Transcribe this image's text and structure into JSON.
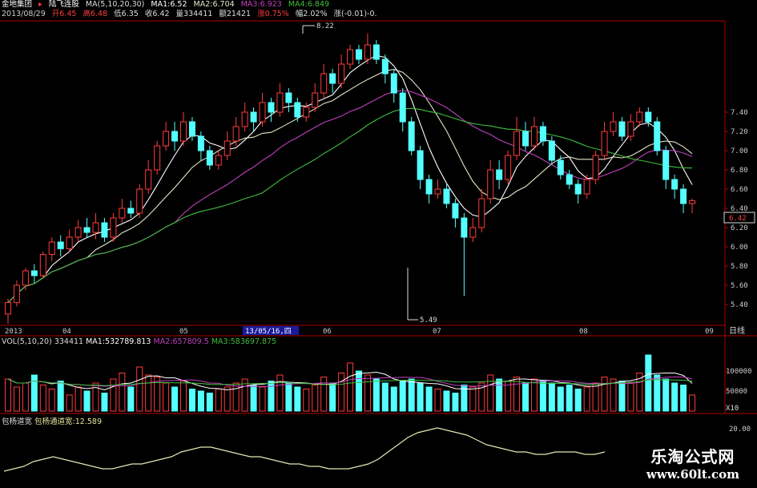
{
  "header": {
    "stock_name": "金地集团",
    "indicator": "陆飞连股",
    "ma_params": "MA(5,10,20,30)",
    "ma1": "MA1:6.52",
    "ma2": "MA2:6.704",
    "ma3": "MA3:6.923",
    "ma4": "MA4:6.849",
    "date": "2013/08/29",
    "open": "开6.45",
    "high": "高6.48",
    "low": "低6.35",
    "close": "收6.42",
    "volume": "量334411",
    "amount": "额21421",
    "change_pct": "涨0.75%",
    "amplitude": "幅2.02%",
    "change": "涨(-0.01)-0."
  },
  "price_axis": {
    "labels": [
      "7.40",
      "7.20",
      "7.00",
      "6.80",
      "6.60",
      "6.40",
      "6.20",
      "6.00",
      "5.80",
      "5.60",
      "5.40"
    ],
    "current_price": "6.42"
  },
  "annotations": {
    "high": "8.22",
    "low": "5.49"
  },
  "time_axis": {
    "labels": [
      "2013",
      "04",
      "05",
      "06",
      "07",
      "08",
      "09"
    ],
    "cursor_date": "13/05/16,四",
    "period": "日线"
  },
  "volume_pane": {
    "title": "VOL(5,10,20)",
    "vol": "334411",
    "ma1": "MA1:532789.813",
    "ma2": "MA2:657809.5",
    "ma3": "MA3:583697.875",
    "axis_labels": [
      "100000",
      "50000"
    ],
    "unit": "X10"
  },
  "bottom_pane": {
    "title": "包杨道宽",
    "label": "包杨通道宽:12.589",
    "axis_label": "20.00"
  },
  "watermark": {
    "cn": "乐淘公式网",
    "url": "www.60lt.com"
  },
  "colors": {
    "up": "#ff3b3b",
    "down": "#54ffff",
    "ma1": "#ffffff",
    "ma2": "#e6e6c8",
    "ma3": "#c040c0",
    "ma4": "#3fbf3f",
    "border": "#b00000"
  },
  "chart_data": {
    "type": "candlestick",
    "price_ylim": [
      5.2,
      7.5
    ],
    "candles": [
      [
        5.3,
        5.42,
        5.2,
        5.46
      ],
      [
        5.42,
        5.6,
        5.38,
        5.65
      ],
      [
        5.6,
        5.75,
        5.55,
        5.78
      ],
      [
        5.75,
        5.7,
        5.62,
        5.82
      ],
      [
        5.7,
        5.92,
        5.68,
        5.95
      ],
      [
        5.92,
        6.05,
        5.85,
        6.1
      ],
      [
        6.05,
        5.98,
        5.9,
        6.12
      ],
      [
        5.98,
        6.1,
        5.95,
        6.18
      ],
      [
        6.1,
        6.2,
        6.05,
        6.28
      ],
      [
        6.2,
        6.15,
        6.1,
        6.3
      ],
      [
        6.15,
        6.25,
        6.08,
        6.35
      ],
      [
        6.25,
        6.1,
        6.05,
        6.3
      ],
      [
        6.1,
        6.3,
        6.05,
        6.35
      ],
      [
        6.3,
        6.4,
        6.25,
        6.5
      ],
      [
        6.4,
        6.35,
        6.3,
        6.48
      ],
      [
        6.35,
        6.6,
        6.3,
        6.65
      ],
      [
        6.6,
        6.8,
        6.55,
        6.9
      ],
      [
        6.8,
        7.05,
        6.75,
        7.1
      ],
      [
        7.05,
        7.2,
        7.0,
        7.3
      ],
      [
        7.2,
        7.1,
        7.0,
        7.3
      ],
      [
        7.1,
        7.3,
        7.05,
        7.4
      ],
      [
        7.3,
        7.15,
        7.1,
        7.35
      ],
      [
        7.15,
        7.0,
        6.9,
        7.2
      ],
      [
        7.0,
        6.85,
        6.8,
        7.05
      ],
      [
        6.85,
        6.95,
        6.8,
        7.0
      ],
      [
        6.95,
        7.1,
        6.9,
        7.2
      ],
      [
        7.1,
        7.25,
        7.05,
        7.35
      ],
      [
        7.25,
        7.4,
        7.2,
        7.5
      ],
      [
        7.4,
        7.3,
        7.2,
        7.45
      ],
      [
        7.3,
        7.5,
        7.25,
        7.6
      ],
      [
        7.5,
        7.4,
        7.3,
        7.55
      ],
      [
        7.4,
        7.6,
        7.35,
        7.7
      ],
      [
        7.6,
        7.5,
        7.4,
        7.65
      ],
      [
        7.5,
        7.35,
        7.3,
        7.55
      ],
      [
        7.35,
        7.45,
        7.3,
        7.5
      ],
      [
        7.45,
        7.6,
        7.4,
        7.7
      ],
      [
        7.6,
        7.8,
        7.55,
        7.9
      ],
      [
        7.8,
        7.7,
        7.6,
        7.85
      ],
      [
        7.7,
        7.9,
        7.65,
        8.0
      ],
      [
        7.9,
        8.05,
        7.85,
        8.1
      ],
      [
        8.05,
        7.95,
        7.9,
        8.1
      ],
      [
        7.95,
        8.1,
        7.9,
        8.22
      ],
      [
        8.1,
        7.95,
        7.9,
        8.15
      ],
      [
        7.95,
        7.8,
        7.7,
        8.0
      ],
      [
        7.8,
        7.6,
        7.5,
        7.85
      ],
      [
        7.6,
        7.3,
        7.2,
        7.65
      ],
      [
        7.3,
        7.0,
        6.95,
        7.35
      ],
      [
        7.0,
        6.7,
        6.6,
        7.05
      ],
      [
        6.7,
        6.55,
        6.45,
        6.75
      ],
      [
        6.55,
        6.6,
        6.5,
        6.7
      ],
      [
        6.6,
        6.45,
        6.4,
        6.65
      ],
      [
        6.45,
        6.3,
        6.2,
        6.5
      ],
      [
        6.3,
        6.1,
        5.49,
        6.35
      ],
      [
        6.1,
        6.2,
        6.05,
        6.3
      ],
      [
        6.2,
        6.5,
        6.15,
        6.6
      ],
      [
        6.5,
        6.8,
        6.45,
        6.9
      ],
      [
        6.8,
        6.7,
        6.6,
        6.9
      ],
      [
        6.7,
        6.95,
        6.65,
        7.0
      ],
      [
        6.95,
        7.2,
        6.9,
        7.35
      ],
      [
        7.2,
        7.05,
        7.0,
        7.3
      ],
      [
        7.05,
        7.25,
        7.0,
        7.35
      ],
      [
        7.25,
        7.1,
        7.05,
        7.3
      ],
      [
        7.1,
        6.9,
        6.85,
        7.15
      ],
      [
        6.9,
        6.75,
        6.7,
        6.95
      ],
      [
        6.75,
        6.65,
        6.6,
        6.8
      ],
      [
        6.65,
        6.55,
        6.45,
        6.7
      ],
      [
        6.55,
        6.7,
        6.5,
        6.75
      ],
      [
        6.7,
        6.95,
        6.65,
        7.0
      ],
      [
        6.95,
        7.2,
        6.9,
        7.3
      ],
      [
        7.2,
        7.3,
        7.15,
        7.4
      ],
      [
        7.3,
        7.15,
        7.1,
        7.35
      ],
      [
        7.15,
        7.3,
        7.1,
        7.38
      ],
      [
        7.3,
        7.4,
        7.25,
        7.45
      ],
      [
        7.4,
        7.3,
        7.25,
        7.45
      ],
      [
        7.3,
        7.0,
        6.95,
        7.35
      ],
      [
        7.0,
        6.7,
        6.6,
        7.05
      ],
      [
        6.7,
        6.6,
        6.5,
        6.75
      ],
      [
        6.6,
        6.45,
        6.35,
        6.65
      ],
      [
        6.45,
        6.48,
        6.35,
        6.5
      ]
    ],
    "volume_ylim": [
      0,
      150000
    ],
    "volume": [
      80000,
      60000,
      70000,
      90000,
      65000,
      55000,
      75000,
      40000,
      60000,
      50000,
      70000,
      45000,
      80000,
      95000,
      60000,
      110000,
      90000,
      85000,
      70000,
      60000,
      75000,
      55000,
      50000,
      45000,
      55000,
      60000,
      70000,
      80000,
      65000,
      60000,
      75000,
      90000,
      70000,
      60000,
      55000,
      65000,
      85000,
      70000,
      95000,
      120000,
      100000,
      90000,
      80000,
      70000,
      60000,
      75000,
      80000,
      70000,
      60000,
      55000,
      50000,
      45000,
      65000,
      60000,
      70000,
      90000,
      80000,
      75000,
      85000,
      70000,
      80000,
      75000,
      70000,
      60000,
      65000,
      55000,
      60000,
      70000,
      85000,
      80000,
      75000,
      70000,
      95000,
      140000,
      90000,
      80000,
      70000,
      65000,
      40000
    ],
    "indicator_ylim": [
      0,
      25
    ],
    "indicator": [
      4,
      5,
      6,
      8,
      9,
      10,
      9,
      8,
      7,
      6,
      5,
      5,
      6,
      7,
      7,
      8,
      9,
      10,
      12,
      13,
      14,
      14,
      13,
      12,
      11,
      10,
      10,
      9,
      8,
      7,
      7,
      6,
      6,
      5,
      5,
      5,
      6,
      7,
      9,
      12,
      15,
      18,
      20,
      21,
      22,
      21,
      20,
      19,
      17,
      15,
      14,
      13,
      12,
      12,
      11,
      11,
      12,
      12,
      12,
      11,
      11,
      12
    ]
  }
}
